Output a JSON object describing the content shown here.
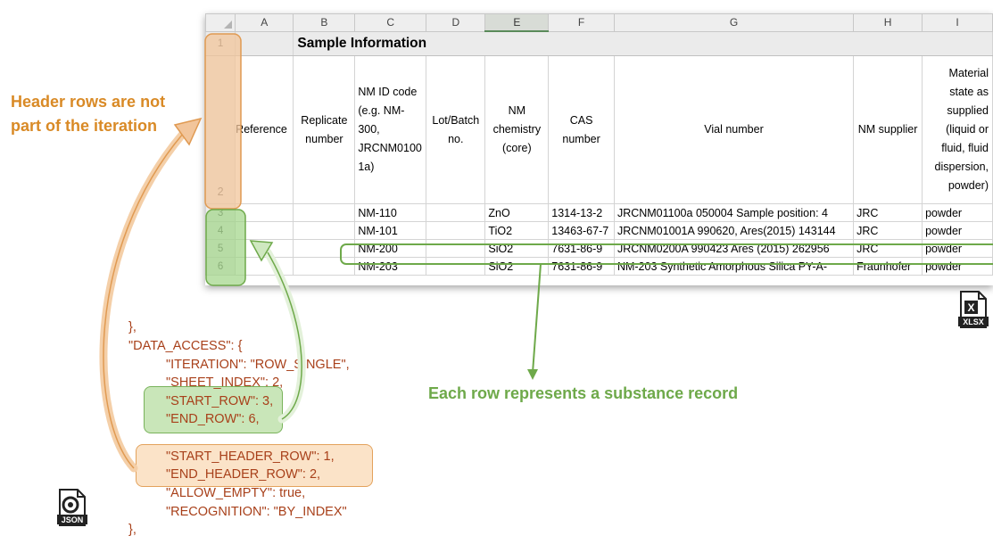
{
  "colors": {
    "header_accent": "#d98a26",
    "record_accent": "#6ea94a",
    "json_text": "#a8401a"
  },
  "sheet": {
    "columns": [
      "A",
      "B",
      "C",
      "D",
      "E",
      "F",
      "G",
      "H",
      "I"
    ],
    "row_numbers": [
      "1",
      "2",
      "3",
      "4",
      "5",
      "6"
    ],
    "title": "Sample Information",
    "headers": [
      "Reference",
      "Replicate number",
      "NM ID code (e.g. NM-300, JRCNM0100 1a)",
      "Lot/Batch no.",
      "NM chemistry (core)",
      "CAS number",
      "Vial number",
      "NM supplier",
      "Material state as supplied (liquid or fluid, fluid dispersion, powder)"
    ],
    "rows": [
      [
        "",
        "",
        "NM-110",
        "",
        "ZnO",
        "1314-13-2",
        "JRCNM01100a 050004 Sample position: 4",
        "JRC",
        "powder"
      ],
      [
        "",
        "",
        "NM-101",
        "",
        "TiO2",
        "13463-67-7",
        "JRCNM01001A 990620, Ares(2015) 143144",
        "JRC",
        "powder"
      ],
      [
        "",
        "",
        "NM-200",
        "",
        "SiO2",
        "7631-86-9",
        "JRCNM0200A 990423 Ares (2015) 262956",
        "JRC",
        "powder"
      ],
      [
        "",
        "",
        "NM-203",
        "",
        "SiO2",
        "7631-86-9",
        "NM-203 Synthetic Amorphous Silica PY-A-",
        "Fraunhofer",
        "powder"
      ]
    ]
  },
  "annotations": {
    "header_note_line1": "Header rows are not",
    "header_note_line2": "part of the iteration",
    "record_note": "Each row represents a substance record"
  },
  "json_snippet": {
    "lines": [
      "},",
      "\"DATA_ACCESS\": {",
      "\"ITERATION\": \"ROW_SINGLE\",",
      "\"SHEET_INDEX\": 2,",
      "\"START_ROW\": 3,",
      "\"END_ROW\": 6,",
      "\"START_HEADER_ROW\": 1,",
      "\"END_HEADER_ROW\": 2,",
      "\"ALLOW_EMPTY\": true,",
      "\"RECOGNITION\": \"BY_INDEX\"",
      "},"
    ]
  },
  "icons": {
    "xlsx_label": "XLSX",
    "json_label": "JSON"
  }
}
